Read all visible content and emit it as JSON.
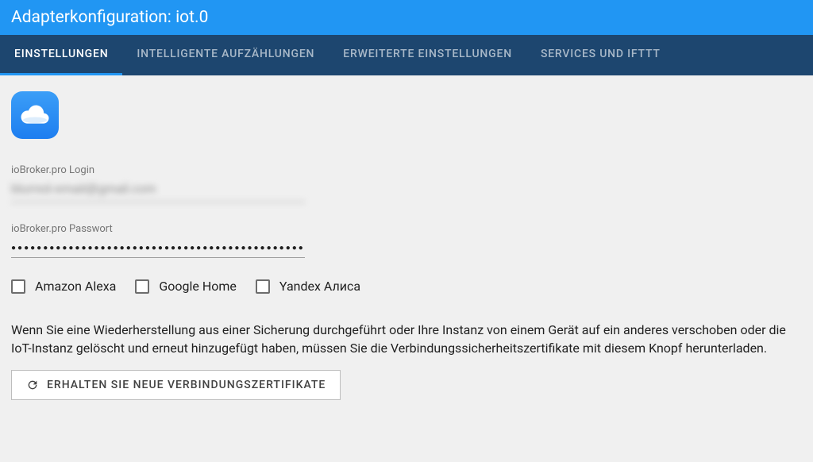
{
  "header": {
    "title": "Adapterkonfiguration: iot.0"
  },
  "tabs": [
    {
      "label": "EINSTELLUNGEN",
      "active": true
    },
    {
      "label": "INTELLIGENTE AUFZÄHLUNGEN",
      "active": false
    },
    {
      "label": "ERWEITERTE EINSTELLUNGEN",
      "active": false
    },
    {
      "label": "SERVICES UND IFTTT",
      "active": false
    }
  ],
  "fields": {
    "login": {
      "label": "ioBroker.pro Login",
      "value": "blurred-email@gmail.com"
    },
    "password": {
      "label": "ioBroker.pro Passwort",
      "value": "●●●●●●●●●●●●●●●●●●●●●●●●●●●●●●●●●●●●●●●●●●●●●●●●●●"
    }
  },
  "checkboxes": [
    {
      "label": "Amazon Alexa",
      "checked": false
    },
    {
      "label": "Google Home",
      "checked": false
    },
    {
      "label": "Yandex Алиса",
      "checked": false
    }
  ],
  "info_text": "Wenn Sie eine Wiederherstellung aus einer Sicherung durchgeführt oder Ihre Instanz von einem Gerät auf ein anderes verschoben oder die IoT-Instanz gelöscht und erneut hinzugefügt haben, müssen Sie die Verbindungssicherheitszertifikate mit diesem Knopf herunterladen.",
  "cert_button": {
    "label": "ERHALTEN SIE NEUE VERBINDUNGSZERTIFIKATE"
  }
}
